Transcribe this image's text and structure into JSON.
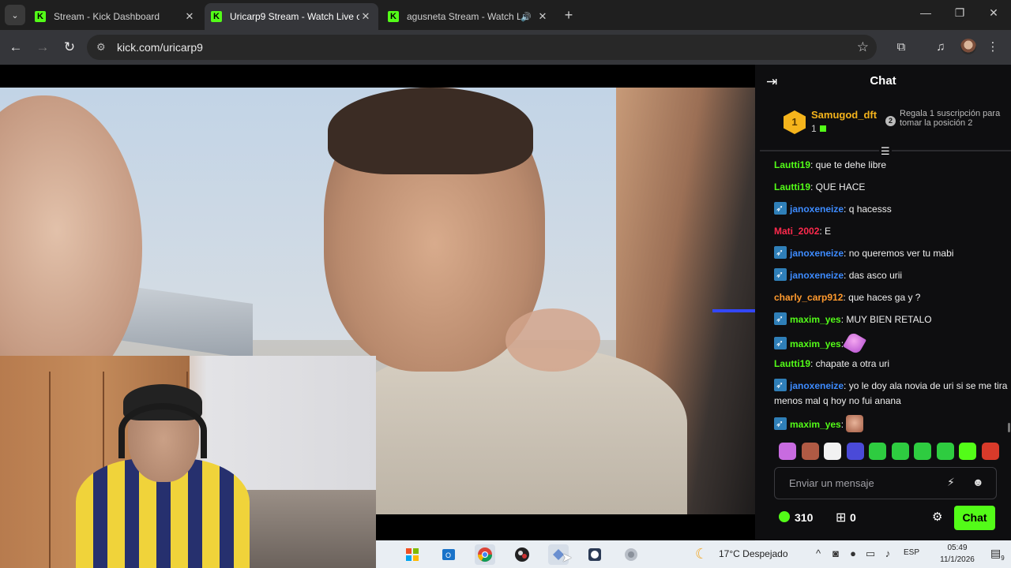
{
  "browser": {
    "tabs": [
      {
        "title": "Stream - Kick Dashboard",
        "active": false,
        "favicon": "kick-logo-icon"
      },
      {
        "title": "Uricarp9 Stream - Watch Live o",
        "active": true,
        "favicon": "kick-logo-icon"
      },
      {
        "title": "agusneta Stream - Watch Li",
        "active": false,
        "favicon": "kick-logo-icon",
        "audio": true
      }
    ],
    "url": "kick.com/uricarp9",
    "favicon_letter": "K",
    "accent_color": "#53fc18"
  },
  "chat": {
    "title": "Chat",
    "pinned_gift": {
      "rank": "1",
      "username": "Samugod_dft",
      "count": "1",
      "position_badge": "2",
      "message": "Regala 1 suscripción para tomar la posición 2"
    },
    "messages": [
      {
        "user": "Lautti19",
        "color": "#53fc18",
        "badge": false,
        "text": ": que te dehe libre"
      },
      {
        "user": "Lautti19",
        "color": "#53fc18",
        "badge": false,
        "text": ": QUE HACE"
      },
      {
        "user": "janoxeneize",
        "color": "#3d8bff",
        "badge": true,
        "text": ": q hacesss"
      },
      {
        "user": "Mati_2002",
        "color": "#ff2a4d",
        "badge": false,
        "text": ": E"
      },
      {
        "user": "janoxeneize",
        "color": "#3d8bff",
        "badge": true,
        "text": ": no queremos ver tu mabi"
      },
      {
        "user": "janoxeneize",
        "color": "#3d8bff",
        "badge": true,
        "text": ": das asco urii"
      },
      {
        "user": "charly_carp912",
        "color": "#ff9a2e",
        "badge": false,
        "text": ": que haces ga y ?"
      },
      {
        "user": "maxim_yes",
        "color": "#53fc18",
        "badge": true,
        "text": ": MUY BIEN RETALO"
      },
      {
        "user": "maxim_yes",
        "color": "#53fc18",
        "badge": true,
        "text": ": ",
        "emote": "pink"
      },
      {
        "user": "Lautti19",
        "color": "#53fc18",
        "badge": false,
        "text": ": chapate a otra uri"
      },
      {
        "user": "janoxeneize",
        "color": "#3d8bff",
        "badge": true,
        "text": ": yo le doy ala novia de uri si se me tira menos mal q hoy no fui anana"
      },
      {
        "user": "maxim_yes",
        "color": "#53fc18",
        "badge": true,
        "text": ": ",
        "emote": "face"
      }
    ],
    "emote_bar_colors": [
      "#c86be0",
      "#b05a44",
      "#f2f2f2",
      "#4a4ad8",
      "#2ecc40",
      "#2ecc40",
      "#2ecc40",
      "#2ecc40",
      "#53fc18",
      "#d83a2a"
    ],
    "input_placeholder": "Enviar un mensaje",
    "points": "310",
    "gifts": "0",
    "chat_button": "Chat"
  },
  "taskbar": {
    "weather": "17°C  Despejado",
    "language": "ESP",
    "time": "05:49",
    "date": "11/1/2026",
    "notifications": "9"
  }
}
